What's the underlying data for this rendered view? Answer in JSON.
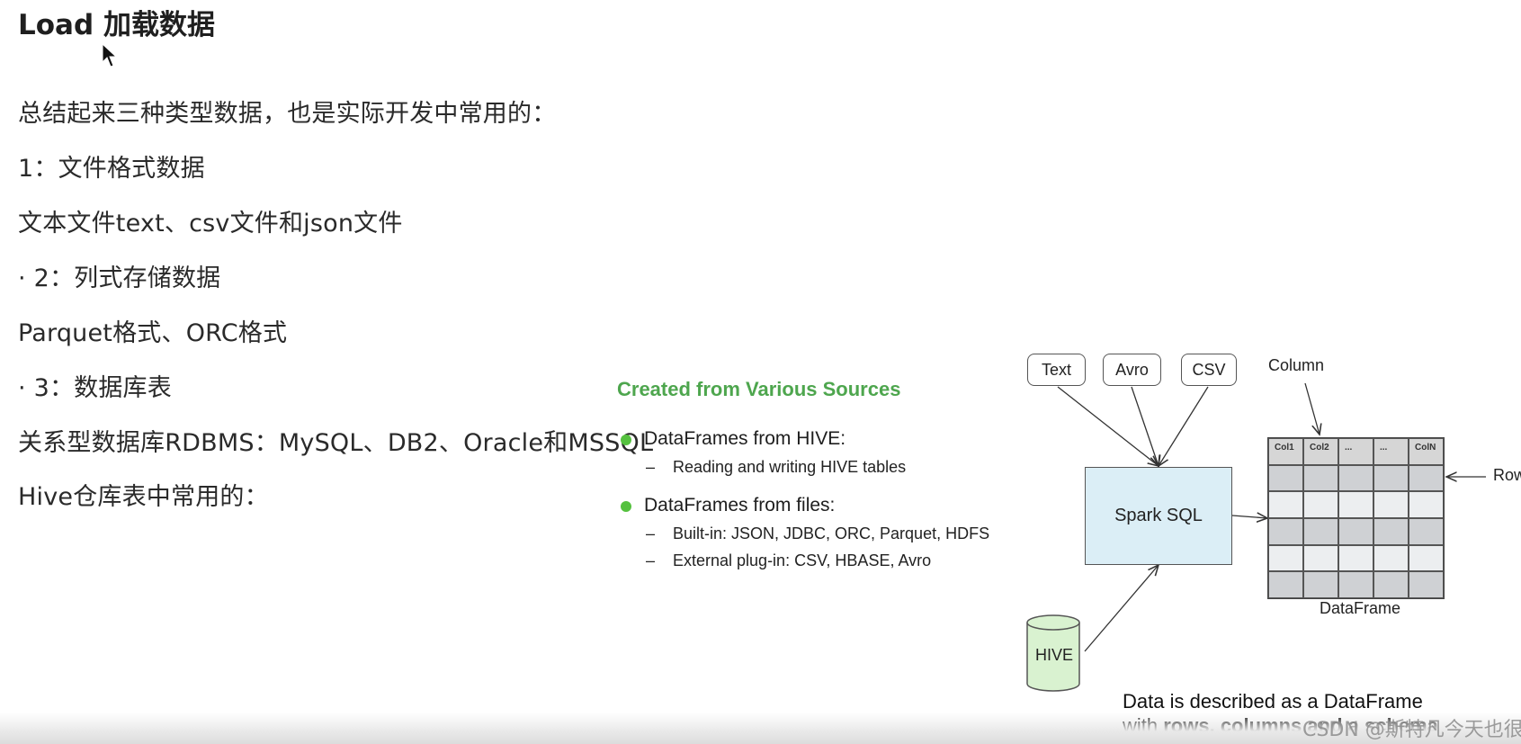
{
  "document": {
    "title": "Load 加载数据",
    "lines": [
      "总结起来三种类型数据，也是实际开发中常用的：",
      "1：文件格式数据",
      "文本文件text、csv文件和json文件",
      "· 2：列式存储数据",
      "Parquet格式、ORC格式",
      "· 3：数据库表",
      "关系型数据库RDBMS：MySQL、DB2、Oracle和MSSQL",
      "Hive仓库表中常用的："
    ]
  },
  "slide": {
    "title": "Created from Various Sources",
    "bullets": [
      {
        "label": "DataFrames from HIVE:",
        "subs": [
          "Reading and writing HIVE tables"
        ]
      },
      {
        "label": "DataFrames from files:",
        "subs": [
          "Built-in: JSON, JDBC, ORC, Parquet, HDFS",
          "External plug-in: CSV, HBASE, Avro"
        ]
      }
    ],
    "accent_color": "#4ea64e",
    "bullet_color": "#55c13f"
  },
  "diagram": {
    "sources": [
      "Text",
      "Avro",
      "CSV"
    ],
    "engine": "Spark SQL",
    "database": "HIVE",
    "column_label": "Column",
    "row_label": "Row",
    "dataframe_label": "DataFrame",
    "grid_headers": [
      "Col1",
      "Col2",
      "...",
      "...",
      "ColN"
    ],
    "caption_line1": "Data is described as a DataFrame",
    "caption_line2_prefix": "with ",
    "caption_line2_bold": "rows, columns and a schema"
  },
  "watermark": "CSDN @斯特凡今天也很帅",
  "icons": {
    "cursor": "mouse-pointer-icon",
    "bullet": "green-hexagon-bullet-icon"
  }
}
